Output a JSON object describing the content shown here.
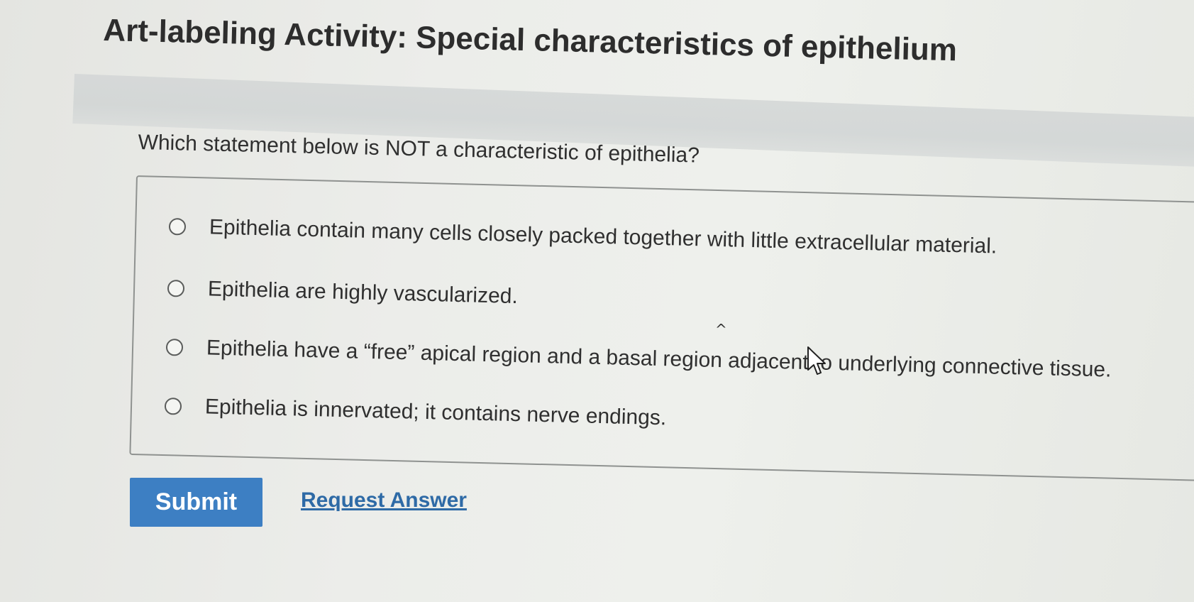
{
  "activity": {
    "title": "Art-labeling Activity: Special characteristics of epithelium"
  },
  "question": {
    "prompt": "Which statement below is NOT a characteristic of epithelia?",
    "options": [
      {
        "label": "Epithelia contain many cells closely packed together with little extracellular material.",
        "selected": false
      },
      {
        "label": "Epithelia are highly vascularized.",
        "selected": false
      },
      {
        "label": "Epithelia have a “free” apical region and a basal region adjacent to underlying connective tissue.",
        "selected": false
      },
      {
        "label": "Epithelia is innervated; it contains nerve endings.",
        "selected": false
      }
    ]
  },
  "actions": {
    "submit_label": "Submit",
    "request_answer_label": "Request Answer"
  },
  "colors": {
    "submit_background": "#3d7fc3",
    "link": "#2e6aa6",
    "border": "#8f9290"
  },
  "icons": {
    "radio": "radio-empty-icon",
    "cursor": "mouse-pointer-icon"
  }
}
